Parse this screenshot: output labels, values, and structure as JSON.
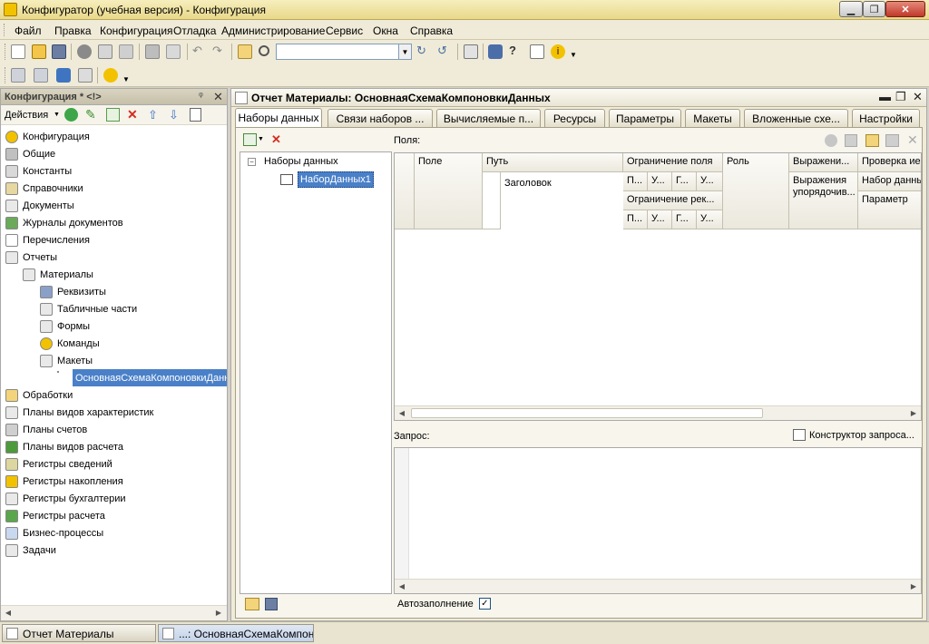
{
  "window": {
    "title": "Конфигуратор (учебная версия) - Конфигурация"
  },
  "menu": [
    "Файл",
    "Правка",
    "Конфигурация",
    "Отладка",
    "Администрирование",
    "Сервис",
    "Окна",
    "Справка"
  ],
  "left_panel": {
    "title": "Конфигурация * <!>",
    "actions_label": "Действия",
    "tree": [
      {
        "label": "Конфигурация",
        "icon": "config-icon",
        "level": 0,
        "expander": false
      },
      {
        "label": "Общие",
        "icon": "common-icon",
        "level": 0,
        "expander": "+"
      },
      {
        "label": "Константы",
        "icon": "constants-icon",
        "level": 0,
        "expander": false
      },
      {
        "label": "Справочники",
        "icon": "catalogs-icon",
        "level": 0,
        "expander": "+"
      },
      {
        "label": "Документы",
        "icon": "documents-icon",
        "level": 0,
        "expander": "+"
      },
      {
        "label": "Журналы документов",
        "icon": "journals-icon",
        "level": 0,
        "expander": false
      },
      {
        "label": "Перечисления",
        "icon": "enums-icon",
        "level": 0,
        "expander": false
      },
      {
        "label": "Отчеты",
        "icon": "reports-icon",
        "level": 0,
        "expander": "-"
      },
      {
        "label": "Материалы",
        "icon": "report-icon",
        "level": 1,
        "expander": "-"
      },
      {
        "label": "Реквизиты",
        "icon": "attributes-icon",
        "level": 2,
        "expander": false
      },
      {
        "label": "Табличные части",
        "icon": "tabular-icon",
        "level": 2,
        "expander": false
      },
      {
        "label": "Формы",
        "icon": "forms-icon",
        "level": 2,
        "expander": false
      },
      {
        "label": "Команды",
        "icon": "commands-icon",
        "level": 2,
        "expander": false
      },
      {
        "label": "Макеты",
        "icon": "templates-icon",
        "level": 2,
        "expander": "-"
      },
      {
        "label": "ОсновнаяСхемаКомпоновкиДанных",
        "icon": "schema-icon",
        "level": 3,
        "expander": false,
        "selected": true
      },
      {
        "label": "Обработки",
        "icon": "processing-icon",
        "level": 0,
        "expander": false
      },
      {
        "label": "Планы видов характеристик",
        "icon": "chart-char-icon",
        "level": 0,
        "expander": false
      },
      {
        "label": "Планы счетов",
        "icon": "accounts-icon",
        "level": 0,
        "expander": false
      },
      {
        "label": "Планы видов расчета",
        "icon": "calc-types-icon",
        "level": 0,
        "expander": false
      },
      {
        "label": "Регистры сведений",
        "icon": "info-reg-icon",
        "level": 0,
        "expander": false
      },
      {
        "label": "Регистры накопления",
        "icon": "accum-reg-icon",
        "level": 0,
        "expander": "+"
      },
      {
        "label": "Регистры бухгалтерии",
        "icon": "acc-reg-icon",
        "level": 0,
        "expander": false
      },
      {
        "label": "Регистры расчета",
        "icon": "calc-reg-icon",
        "level": 0,
        "expander": false
      },
      {
        "label": "Бизнес-процессы",
        "icon": "bp-icon",
        "level": 0,
        "expander": false
      },
      {
        "label": "Задачи",
        "icon": "tasks-icon",
        "level": 0,
        "expander": false
      }
    ]
  },
  "editor": {
    "title": "Отчет Материалы: ОсновнаяСхемаКомпоновкиДанных",
    "tabs": [
      "Наборы данных",
      "Связи наборов ...",
      "Вычисляемые п...",
      "Ресурсы",
      "Параметры",
      "Макеты",
      "Вложенные схе...",
      "Настройки"
    ],
    "active_tab": 0,
    "datasets": {
      "root": "Наборы данных",
      "child": "НаборДанных1"
    },
    "fields_label": "Поля:",
    "grid": {
      "headers": {
        "field": "Поле",
        "path": "Путь",
        "restriction": "Ограничение поля",
        "restriction_sub": [
          "П...",
          "У...",
          "Г...",
          "У..."
        ],
        "restriction_req": "Ограничение рек...",
        "restriction_req_sub": [
          "П...",
          "У...",
          "Г...",
          "У..."
        ],
        "role": "Роль",
        "expression": "Выражени...",
        "expression_order": "Выражения упорядочив...",
        "check": "Проверка иер",
        "check_set": "Набор данны",
        "check_param": "Параметр"
      },
      "title_col": "Заголовок"
    },
    "query_label": "Запрос:",
    "query_builder": "Конструктор запроса...",
    "autofill_label": "Автозаполнение",
    "autofill_checked": "✓"
  },
  "taskbar": [
    {
      "label": "Отчет Материалы",
      "active": false
    },
    {
      "label": "...: ОсновнаяСхемаКомпон...",
      "active": true
    }
  ],
  "colors": {
    "selection": "#4a80c8",
    "panel_bg": "#f0ebd8"
  }
}
